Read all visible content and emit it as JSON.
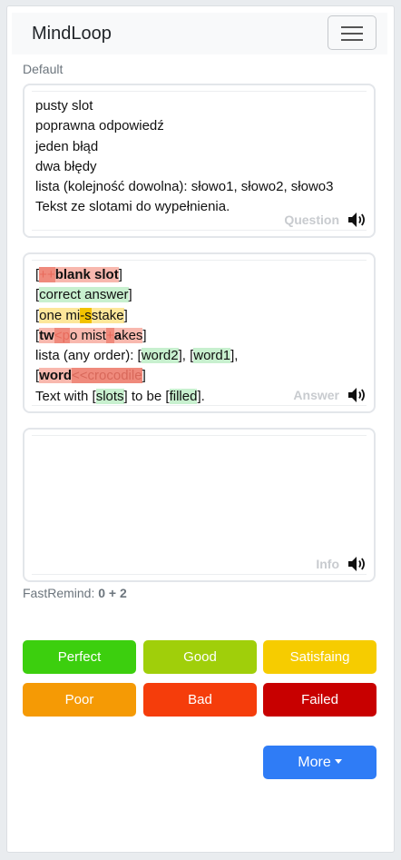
{
  "app": {
    "title": "MindLoop"
  },
  "deck": {
    "name": "Default"
  },
  "question": {
    "lines": [
      "pusty slot",
      "poprawna odpowiedź",
      "jeden błąd",
      "dwa błędy",
      "lista (kolejność dowolna): słowo1, słowo2, słowo3",
      "Tekst ze slotami do wypełnienia."
    ],
    "label": "Question"
  },
  "answer": {
    "label": "Answer",
    "line1": {
      "open": "[",
      "marker": "++",
      "word": "blank slot",
      "close": "]"
    },
    "line2": {
      "open": "[",
      "slot": "correct answer",
      "close": "]"
    },
    "line3": {
      "open": "[",
      "part1": "one mi",
      "marker": "-s",
      "part2": "stake",
      "close": "]"
    },
    "line4": {
      "open": "[",
      "l1": "t",
      "l2": "w",
      "marker1": "<p",
      "part1": "o mist",
      "marker2": "+",
      "l3": "a",
      "part2": "kes",
      "close": "]"
    },
    "line5": {
      "prefix": "lista (any order): [",
      "slot1": "word2",
      "mid": "], [",
      "slot2": "word1",
      "close": "],"
    },
    "line6": {
      "open": "[",
      "word": "word",
      "marker": "<<crocodile",
      "close": "]"
    },
    "line7": {
      "prefix": "Text with [",
      "slot1": "slots",
      "mid": "] to be [",
      "slot2": "filled",
      "close": "]."
    }
  },
  "info": {
    "label": "Info"
  },
  "fastremind": {
    "label": "FastRemind:",
    "value": "0 + 2"
  },
  "grades": [
    {
      "label": "Perfect",
      "color": "#3ccf0e"
    },
    {
      "label": "Good",
      "color": "#a0cf0a"
    },
    {
      "label": "Satisfaing",
      "color": "#f6cc00"
    },
    {
      "label": "Poor",
      "color": "#f59a05"
    },
    {
      "label": "Bad",
      "color": "#f53d0b"
    },
    {
      "label": "Failed",
      "color": "#c80000"
    }
  ],
  "more": {
    "label": "More"
  },
  "icons": {
    "menu": "hamburger-menu-icon",
    "speaker": "speaker-icon",
    "caret": "caret-down-icon"
  },
  "colors": {
    "correct": "#c8f0cf",
    "error": "#f8b8ae",
    "warning": "#fde79a",
    "primary": "#2f7cf6"
  }
}
